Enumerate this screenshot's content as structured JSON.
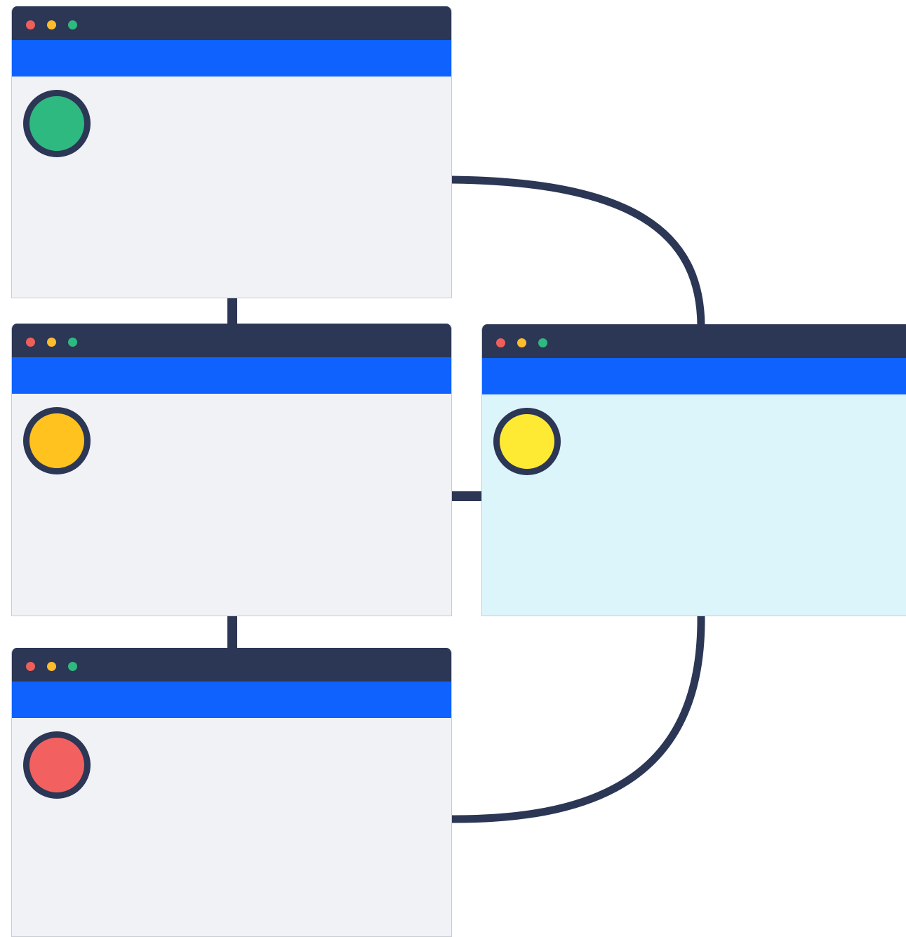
{
  "colors": {
    "titlebar": "#2c3655",
    "header_band": "#0f62fe",
    "content_default": "#f1f2f6",
    "content_highlight": "#dcf5fb",
    "connector": "#2c3655",
    "traffic_red": "#ef5f5a",
    "traffic_amber": "#fdbc2d",
    "traffic_green": "#2eb980"
  },
  "windows": [
    {
      "id": "window-1",
      "status_color": "#2eb980",
      "content_color": "#f1f2f6"
    },
    {
      "id": "window-2",
      "status_color": "#ffc21f",
      "content_color": "#f1f2f6"
    },
    {
      "id": "window-3",
      "status_color": "#f26160",
      "content_color": "#f1f2f6"
    },
    {
      "id": "window-4",
      "status_color": "#ffea33",
      "content_color": "#dcf5fb"
    }
  ],
  "connections": [
    {
      "from": "window-1",
      "to": "window-2"
    },
    {
      "from": "window-2",
      "to": "window-3"
    },
    {
      "from": "window-2",
      "to": "window-4"
    },
    {
      "from": "window-1",
      "to": "window-4"
    },
    {
      "from": "window-3",
      "to": "window-4"
    }
  ]
}
